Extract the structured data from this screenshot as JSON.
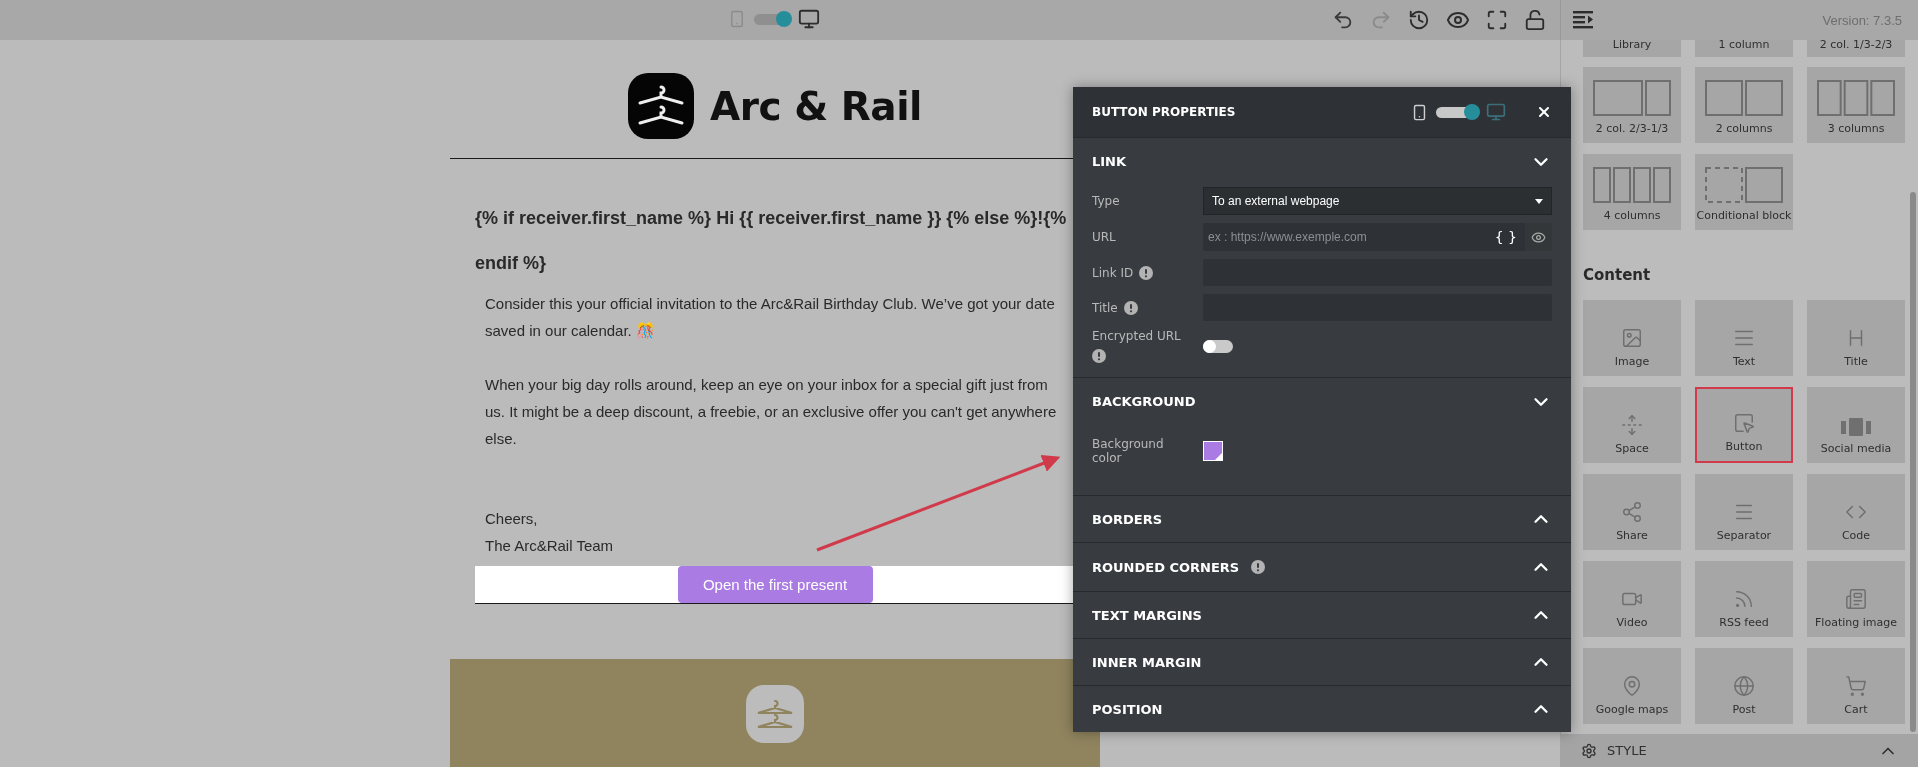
{
  "toolbar": {
    "device_toggle": {
      "on": true
    },
    "version": "Version: 7.3.5"
  },
  "email": {
    "brand": "Arc & Rail",
    "greeting": "{% if receiver.first_name %} Hi {{ receiver.first_name }} {% else %}!{% endif %}",
    "paragraphs": [
      "Consider this your official invitation to the Arc&Rail Birthday Club. We’ve got your date saved in our calendar. 🎊",
      "When your big day rolls around, keep an eye on your inbox for a special gift just from us. It might be a deep discount, a freebie, or an exclusive offer you can't get anywhere else."
    ],
    "signoff": [
      "Cheers,",
      "The Arc&Rail Team"
    ],
    "button": "Open the first present"
  },
  "panel": {
    "title": "BUTTON PROPERTIES",
    "device_toggle": {
      "on": true
    },
    "sections": [
      {
        "title": "LINK",
        "expanded": true,
        "info": false,
        "fields": [
          {
            "kind": "select",
            "label": "Type",
            "info": false,
            "value": "To an external webpage"
          },
          {
            "kind": "url",
            "label": "URL",
            "info": false,
            "placeholder": "ex : https://www.exemple.com",
            "code": "{ }"
          },
          {
            "kind": "text",
            "label": "Link ID",
            "info": true
          },
          {
            "kind": "text",
            "label": "Title",
            "info": true
          },
          {
            "kind": "toggle",
            "label": "Encrypted URL",
            "info": true,
            "on": false
          }
        ]
      },
      {
        "title": "BACKGROUND",
        "expanded": true,
        "info": false,
        "fields": [
          {
            "kind": "color",
            "label": "Background color",
            "info": false,
            "color": "#a97be3"
          }
        ]
      },
      {
        "title": "BORDERS",
        "expanded": false,
        "info": false
      },
      {
        "title": "ROUNDED CORNERS",
        "expanded": false,
        "info": true
      },
      {
        "title": "TEXT MARGINS",
        "expanded": false,
        "info": false
      },
      {
        "title": "INNER MARGIN",
        "expanded": false,
        "info": false
      },
      {
        "title": "POSITION",
        "expanded": false,
        "info": false
      }
    ]
  },
  "sidebar": {
    "partial_blocks": [
      {
        "label": "Library"
      },
      {
        "label": "1 column"
      },
      {
        "label": "2 col. 1/3-2/3"
      }
    ],
    "layout_blocks": [
      {
        "label": "2 col. 2/3-1/3"
      },
      {
        "label": "2 columns"
      },
      {
        "label": "3 columns"
      },
      {
        "label": "4 columns"
      },
      {
        "label": "Conditional block"
      }
    ],
    "content_title": "Content",
    "content_blocks": [
      {
        "label": "Image",
        "highlighted": false
      },
      {
        "label": "Text",
        "highlighted": false
      },
      {
        "label": "Title",
        "highlighted": false
      },
      {
        "label": "Space",
        "highlighted": false
      },
      {
        "label": "Button",
        "highlighted": true
      },
      {
        "label": "Social media",
        "highlighted": false
      },
      {
        "label": "Share",
        "highlighted": false
      },
      {
        "label": "Separator",
        "highlighted": false
      },
      {
        "label": "Code",
        "highlighted": false
      },
      {
        "label": "Video",
        "highlighted": false
      },
      {
        "label": "RSS feed",
        "highlighted": false
      },
      {
        "label": "Floating image",
        "highlighted": false
      },
      {
        "label": "Google maps",
        "highlighted": false
      },
      {
        "label": "Post",
        "highlighted": false
      },
      {
        "label": "Cart",
        "highlighted": false
      }
    ],
    "style_label": "STYLE"
  }
}
